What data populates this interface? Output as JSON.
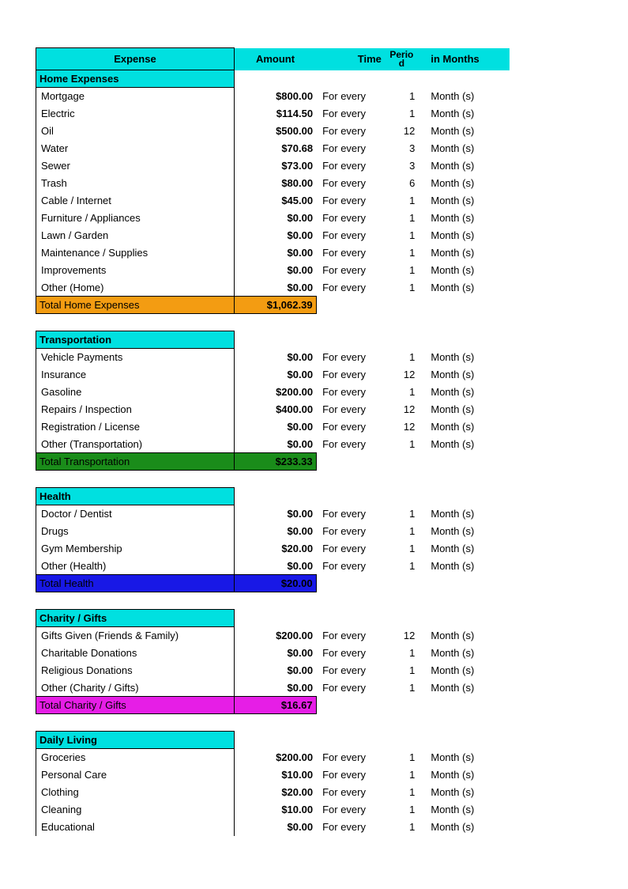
{
  "headers": {
    "expense": "Expense",
    "amount": "Amount",
    "time": "Time",
    "period_top": "Perio",
    "period_bot": "d",
    "months": "in Months"
  },
  "time_label": "For every",
  "unit_label": "Month (s)",
  "sections": [
    {
      "name": "Home Expenses",
      "rows": [
        {
          "label": "Mortgage",
          "amount": "$800.00",
          "period": "1"
        },
        {
          "label": "Electric",
          "amount": "$114.50",
          "period": "1"
        },
        {
          "label": "Oil",
          "amount": "$500.00",
          "period": "12"
        },
        {
          "label": "Water",
          "amount": "$70.68",
          "period": "3"
        },
        {
          "label": "Sewer",
          "amount": "$73.00",
          "period": "3"
        },
        {
          "label": "Trash",
          "amount": "$80.00",
          "period": "6"
        },
        {
          "label": "Cable / Internet",
          "amount": "$45.00",
          "period": "1"
        },
        {
          "label": "Furniture / Appliances",
          "amount": "$0.00",
          "period": "1"
        },
        {
          "label": "Lawn / Garden",
          "amount": "$0.00",
          "period": "1"
        },
        {
          "label": "Maintenance / Supplies",
          "amount": "$0.00",
          "period": "1"
        },
        {
          "label": "Improvements",
          "amount": "$0.00",
          "period": "1"
        },
        {
          "label": "Other (Home)",
          "amount": "$0.00",
          "period": "1"
        }
      ],
      "total_label": "Total Home Expenses",
      "total_amount": "$1,062.39",
      "total_bg": "#f39c12",
      "total_fg": "#000"
    },
    {
      "name": "Transportation",
      "rows": [
        {
          "label": "Vehicle Payments",
          "amount": "$0.00",
          "period": "1"
        },
        {
          "label": "Insurance",
          "amount": "$0.00",
          "period": "12"
        },
        {
          "label": "Gasoline",
          "amount": "$200.00",
          "period": "1"
        },
        {
          "label": "Repairs / Inspection",
          "amount": "$400.00",
          "period": "12"
        },
        {
          "label": "Registration / License",
          "amount": "$0.00",
          "period": "12"
        },
        {
          "label": "Other (Transportation)",
          "amount": "$0.00",
          "period": "1"
        }
      ],
      "total_label": "Total Transportation",
      "total_amount": "$233.33",
      "total_bg": "#1a8c1a",
      "total_fg": "#000"
    },
    {
      "name": "Health",
      "rows": [
        {
          "label": "Doctor / Dentist",
          "amount": "$0.00",
          "period": "1"
        },
        {
          "label": "Drugs",
          "amount": "$0.00",
          "period": "1"
        },
        {
          "label": "Gym Membership",
          "amount": "$20.00",
          "period": "1"
        },
        {
          "label": "Other (Health)",
          "amount": "$0.00",
          "period": "1"
        }
      ],
      "total_label": "Total Health",
      "total_amount": "$20.00",
      "total_bg": "#1818e6",
      "total_fg": "#000"
    },
    {
      "name": "Charity / Gifts",
      "rows": [
        {
          "label": "Gifts Given (Friends & Family)",
          "amount": "$200.00",
          "period": "12"
        },
        {
          "label": "Charitable Donations",
          "amount": "$0.00",
          "period": "1"
        },
        {
          "label": "Religious Donations",
          "amount": "$0.00",
          "period": "1"
        },
        {
          "label": "Other (Charity / Gifts)",
          "amount": "$0.00",
          "period": "1"
        }
      ],
      "total_label": "Total Charity / Gifts",
      "total_amount": "$16.67",
      "total_bg": "#e61ee6",
      "total_fg": "#000"
    },
    {
      "name": "Daily Living",
      "rows": [
        {
          "label": "Groceries",
          "amount": "$200.00",
          "period": "1"
        },
        {
          "label": "Personal Care",
          "amount": "$10.00",
          "period": "1"
        },
        {
          "label": "Clothing",
          "amount": "$20.00",
          "period": "1"
        },
        {
          "label": "Cleaning",
          "amount": "$10.00",
          "period": "1"
        },
        {
          "label": "Educational",
          "amount": "$0.00",
          "period": "1"
        }
      ],
      "total_label": null,
      "total_amount": null
    }
  ]
}
